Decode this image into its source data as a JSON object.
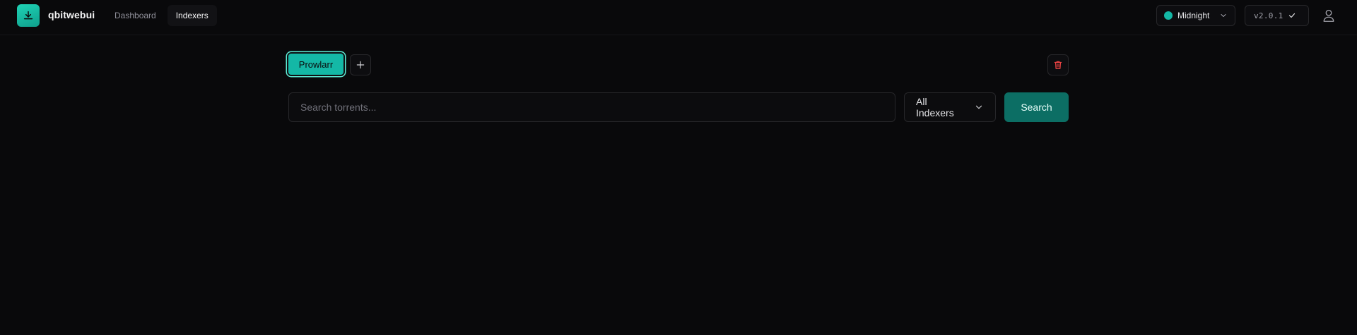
{
  "header": {
    "brand": "qbitwebui",
    "nav": [
      {
        "label": "Dashboard",
        "active": false
      },
      {
        "label": "Indexers",
        "active": true
      }
    ],
    "theme": {
      "label": "Midnight",
      "color": "#14b8a6"
    },
    "version": {
      "label": "v2.0.1"
    },
    "icons": {
      "logo": "download-icon",
      "theme_chevron": "chevron-down-icon",
      "version_status": "check-icon",
      "user": "user-icon"
    }
  },
  "indexer_bar": {
    "tabs": [
      {
        "label": "Prowlarr",
        "active": true
      }
    ],
    "add_icon": "plus-icon",
    "delete_icon": "trash-icon"
  },
  "search": {
    "placeholder": "Search torrents...",
    "value": "",
    "indexer_select": {
      "selected": "All Indexers"
    },
    "button_label": "Search"
  },
  "colors": {
    "accent": "#14b8a6",
    "accent_dark": "#0c6e64",
    "danger": "#ef4444",
    "background": "#09090b"
  }
}
